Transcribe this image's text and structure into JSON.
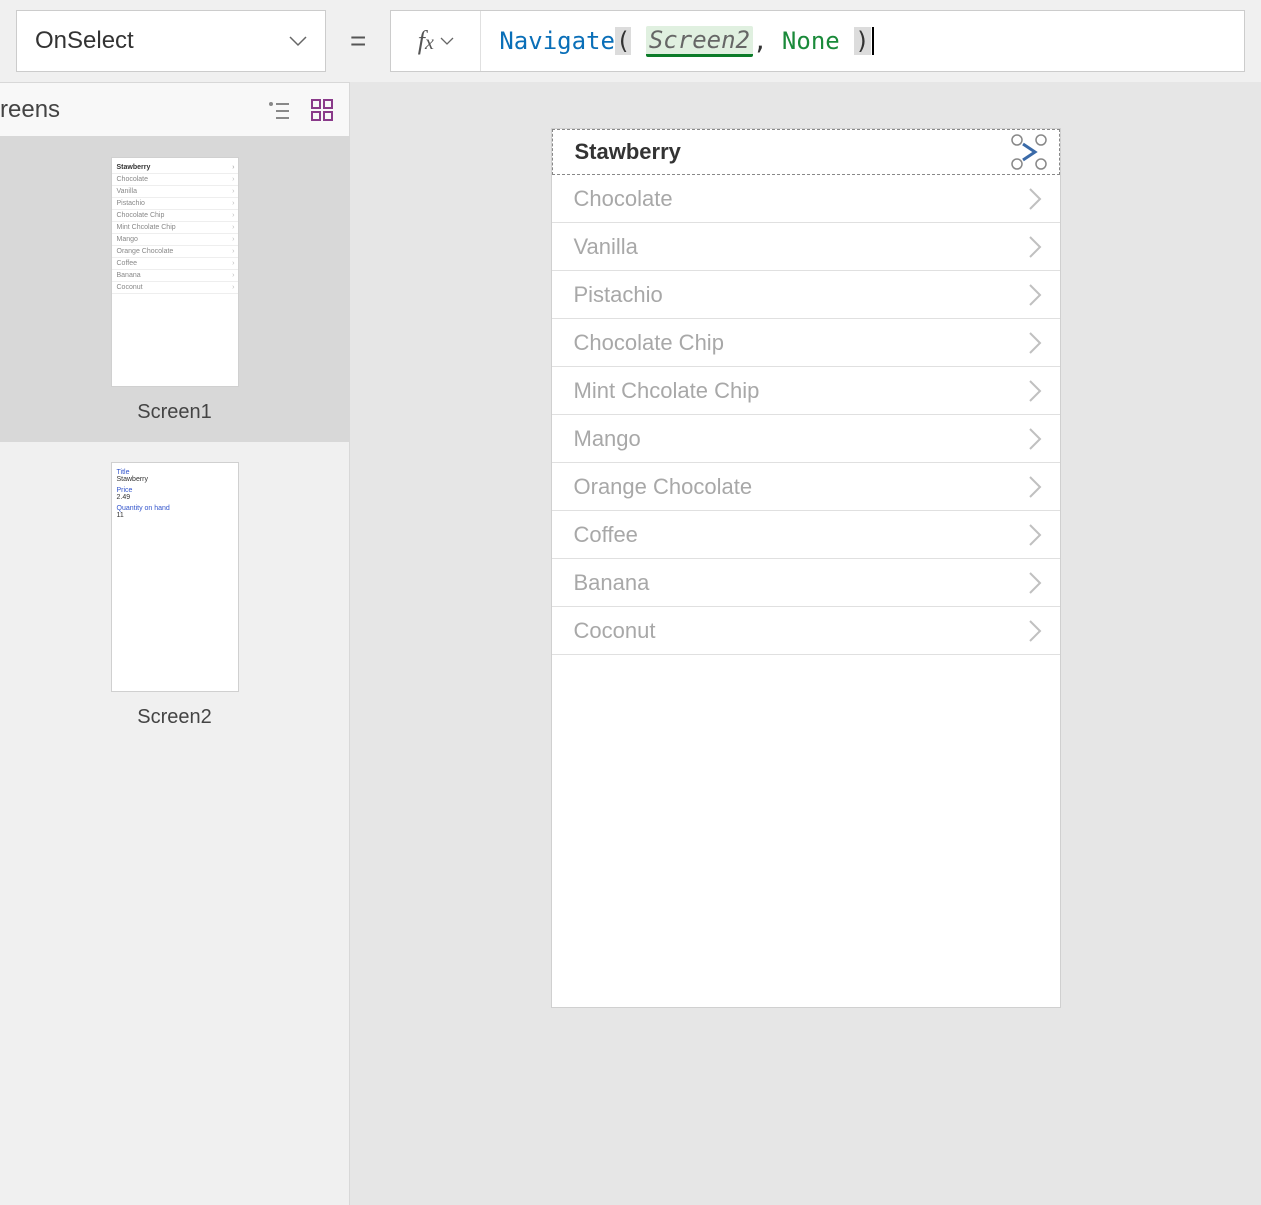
{
  "property_selector": {
    "value": "OnSelect"
  },
  "formula": {
    "function": "Navigate",
    "arg1": "Screen2",
    "arg2": "None"
  },
  "sidebar": {
    "title": "reens",
    "screens": [
      {
        "name": "Screen1",
        "selected": true
      },
      {
        "name": "Screen2",
        "selected": false
      }
    ]
  },
  "thumb2_fields": {
    "title_label": "Title",
    "title_value": "Stawberry",
    "price_label": "Price",
    "price_value": "2.49",
    "qty_label": "Quantity on hand",
    "qty_value": "11"
  },
  "gallery_items": [
    "Stawberry",
    "Chocolate",
    "Vanilla",
    "Pistachio",
    "Chocolate Chip",
    "Mint Chcolate Chip",
    "Mango",
    "Orange Chocolate",
    "Coffee",
    "Banana",
    "Coconut"
  ]
}
